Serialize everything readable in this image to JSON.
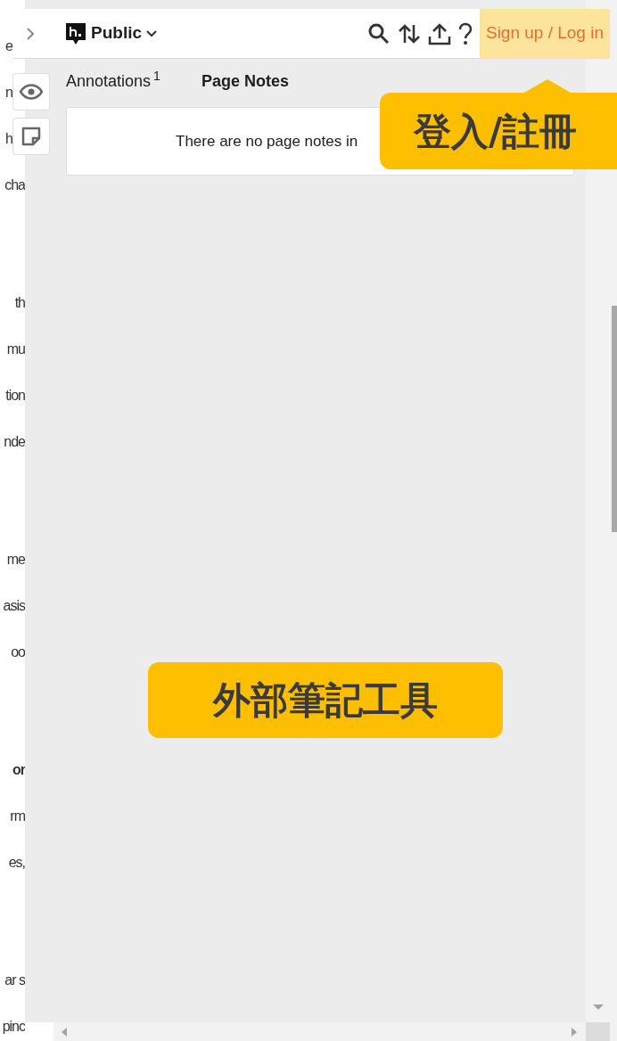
{
  "page_text": [
    {
      "lines": [
        {
          "text": "e",
          "bold": false,
          "kind": "beside_buttons"
        },
        {
          "text": "n",
          "bold": false,
          "kind": "beside_buttons"
        },
        {
          "text": "h",
          "bold": false,
          "kind": "beside_buttons"
        },
        {
          "text": "cha",
          "bold": false,
          "kind": "plain"
        }
      ]
    },
    {
      "lines": [
        {
          "text": "th",
          "bold": false,
          "kind": "plain"
        },
        {
          "text": "mu",
          "bold": false,
          "kind": "plain"
        },
        {
          "text": "tion",
          "bold": false,
          "kind": "plain"
        },
        {
          "text": "nde",
          "bold": false,
          "kind": "plain"
        }
      ]
    },
    {
      "lines": [
        {
          "text": "me",
          "bold": false,
          "kind": "plain"
        },
        {
          "text": "asis",
          "bold": false,
          "kind": "plain"
        },
        {
          "text": "oo",
          "bold": false,
          "kind": "plain"
        }
      ]
    },
    {
      "lines": [
        {
          "text": "or",
          "bold": true,
          "kind": "plain"
        },
        {
          "text": "rm",
          "bold": false,
          "kind": "plain"
        },
        {
          "text": "es,",
          "bold": false,
          "kind": "plain"
        }
      ]
    },
    {
      "lines": [
        {
          "text": "ar s",
          "bold": false,
          "kind": "plain"
        },
        {
          "text": "pinc",
          "bold": false,
          "kind": "plain"
        }
      ]
    }
  ],
  "toolbar": {
    "group": "Public",
    "sign_in": "Sign up / Log in"
  },
  "tabs": [
    {
      "label": "Annotations",
      "count": "1",
      "selected": false
    },
    {
      "label": "Page Notes",
      "selected": true
    }
  ],
  "empty_message": "There are no page notes in",
  "callouts": [
    {
      "text": "登入/註冊"
    },
    {
      "text": "外部筆記工具"
    }
  ]
}
